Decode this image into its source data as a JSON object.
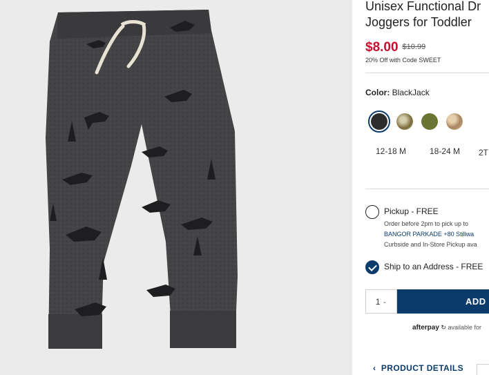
{
  "product": {
    "title_line1": "Unisex Functional Dr",
    "title_line2": "Joggers for Toddler",
    "price_sale": "$8.00",
    "price_original": "$10.99",
    "promo_text": "20% Off with Code SWEET",
    "color_label": "Color:",
    "color_value": "BlackJack",
    "image_alt": "Dinosaur print charcoal joggers"
  },
  "swatches": [
    {
      "name": "BlackJack",
      "color": "#2d2d2d",
      "selected": true
    },
    {
      "name": "Dino print tan",
      "color": "#8a7a55",
      "selected": false
    },
    {
      "name": "Olive",
      "color": "#6b7532",
      "selected": false
    },
    {
      "name": "Camo",
      "color": "#c8a27a",
      "selected": false
    }
  ],
  "sizes": [
    "12-18 M",
    "18-24 M",
    "2T"
  ],
  "fulfillment": {
    "pickup_label": "Pickup - FREE",
    "pickup_note": "Order before 2pm to pick up to",
    "pickup_store": "BANGOR PARKADE +80 Stillwa",
    "pickup_sub": "Curbside and In-Store Pickup ava",
    "ship_label": "Ship to an Address - FREE"
  },
  "cart": {
    "qty_value": "1",
    "add_label": "ADD"
  },
  "afterpay": {
    "brand": "afterpay",
    "text": "available for"
  },
  "product_details_label": "PRODUCT DETAILS",
  "colors": {
    "brand_navy": "#0b3b6b",
    "sale_red": "#c8102e",
    "pants_fabric": "#3d3d3f"
  }
}
